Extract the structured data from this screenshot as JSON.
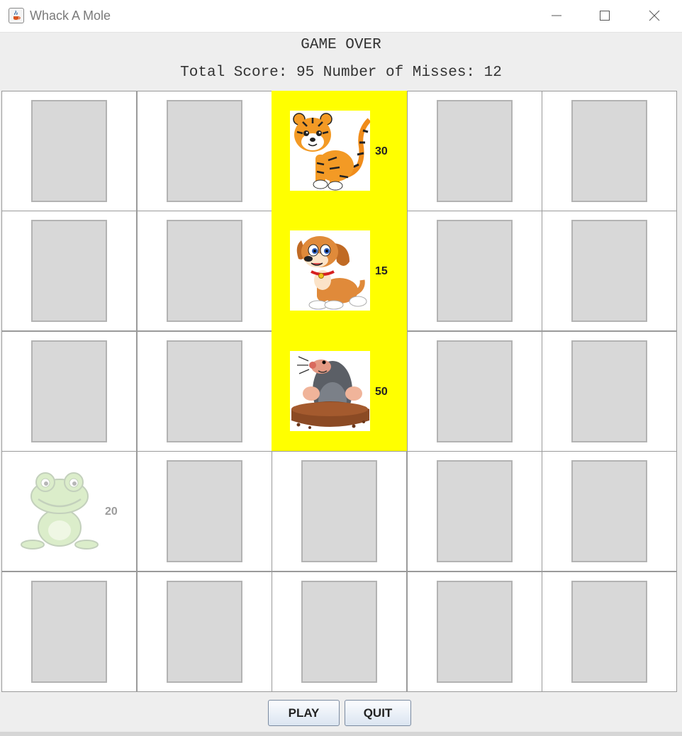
{
  "window": {
    "title": "Whack A Mole"
  },
  "header": {
    "status": "GAME OVER",
    "summary": "Total Score: 95  Number of Misses: 12"
  },
  "grid": {
    "rows": 5,
    "cols": 5,
    "cells": [
      {
        "row": 0,
        "col": 2,
        "animal": "tiger",
        "points": "30",
        "active": true
      },
      {
        "row": 1,
        "col": 2,
        "animal": "dog",
        "points": "15",
        "active": true
      },
      {
        "row": 2,
        "col": 2,
        "animal": "mole",
        "points": "50",
        "active": true
      },
      {
        "row": 3,
        "col": 0,
        "animal": "frog",
        "points": "20",
        "active": false
      }
    ]
  },
  "buttons": {
    "play": "PLAY",
    "quit": "QUIT"
  },
  "colors": {
    "active_cell": "#ffff00",
    "empty_slot": "#d8d8d8"
  }
}
